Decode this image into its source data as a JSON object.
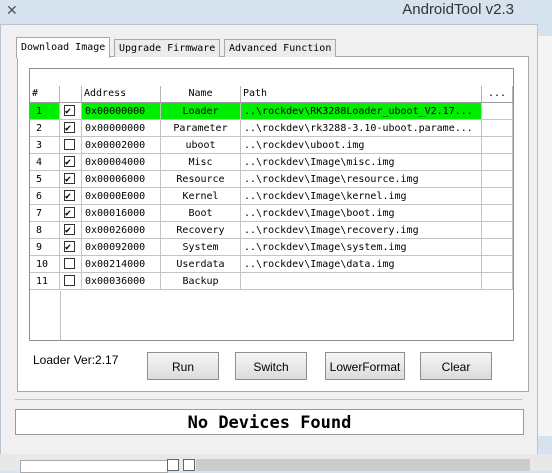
{
  "window": {
    "title": "AndroidTool v2.3"
  },
  "tabs": [
    {
      "label": "Download Image"
    },
    {
      "label": "Upgrade Firmware"
    },
    {
      "label": "Advanced Function"
    }
  ],
  "table": {
    "columns": [
      "#",
      "Address",
      "Name",
      "Path",
      "..."
    ],
    "rows": [
      {
        "num": "1",
        "checked": true,
        "address": "0x00000000",
        "name": "Loader",
        "path": "..\\rockdev\\RK3288Loader_uboot_V2.17...",
        "selected": true
      },
      {
        "num": "2",
        "checked": true,
        "address": "0x00000000",
        "name": "Parameter",
        "path": "..\\rockdev\\rk3288-3.10-uboot.parame..."
      },
      {
        "num": "3",
        "checked": false,
        "address": "0x00002000",
        "name": "uboot",
        "path": "..\\rockdev\\uboot.img"
      },
      {
        "num": "4",
        "checked": true,
        "address": "0x00004000",
        "name": "Misc",
        "path": "..\\rockdev\\Image\\misc.img"
      },
      {
        "num": "5",
        "checked": true,
        "address": "0x00006000",
        "name": "Resource",
        "path": "..\\rockdev\\Image\\resource.img"
      },
      {
        "num": "6",
        "checked": true,
        "address": "0x0000E000",
        "name": "Kernel",
        "path": "..\\rockdev\\Image\\kernel.img"
      },
      {
        "num": "7",
        "checked": true,
        "address": "0x00016000",
        "name": "Boot",
        "path": "..\\rockdev\\Image\\boot.img"
      },
      {
        "num": "8",
        "checked": true,
        "address": "0x00026000",
        "name": "Recovery",
        "path": "..\\rockdev\\Image\\recovery.img"
      },
      {
        "num": "9",
        "checked": true,
        "address": "0x00092000",
        "name": "System",
        "path": "..\\rockdev\\Image\\system.img"
      },
      {
        "num": "10",
        "checked": false,
        "address": "0x00214000",
        "name": "Userdata",
        "path": "..\\rockdev\\Image\\data.img"
      },
      {
        "num": "11",
        "checked": false,
        "address": "0x00036000",
        "name": "Backup",
        "path": ""
      }
    ]
  },
  "controls": {
    "loader_version": "Loader Ver:2.17",
    "run": "Run",
    "switch": "Switch",
    "lower_format": "LowerFormat",
    "clear": "Clear"
  },
  "status": {
    "text": "No Devices Found"
  },
  "colors": {
    "selected_row": "#00ee00"
  }
}
